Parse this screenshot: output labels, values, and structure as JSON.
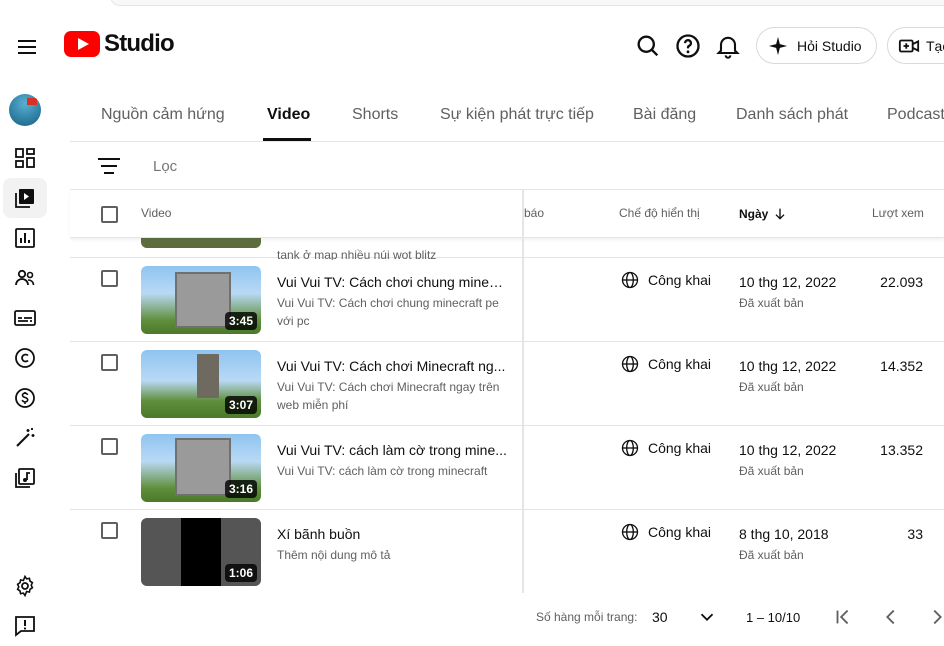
{
  "app": {
    "logo_text": "Studio"
  },
  "header": {
    "ask_label": "Hỏi Studio",
    "create_label": "Tạo",
    "icons": [
      "hamburger-icon",
      "search-icon",
      "help-icon",
      "bell-icon",
      "sparkle-icon",
      "video-add-icon"
    ]
  },
  "tabs": [
    "Nguồn cảm hứng",
    "Video",
    "Shorts",
    "Sự kiện phát trực tiếp",
    "Bài đăng",
    "Danh sách phát",
    "Podcast"
  ],
  "active_tab": "Video",
  "filter": {
    "placeholder": "Lọc"
  },
  "table": {
    "headers": {
      "video": "Video",
      "restrictions": "báo",
      "visibility": "Chế độ hiển thị",
      "date": "Ngày",
      "views": "Lượt xem"
    },
    "partial_row_desc": "tank ở map nhiều núi wot blitz",
    "rows": [
      {
        "title": "Vui Vui TV: Cách chơi chung minecr...",
        "desc": "Vui Vui TV: Cách chơi chung minecraft pe với pc",
        "duration": "3:45",
        "visibility": "Công khai",
        "date": "10 thg 12, 2022",
        "status": "Đã xuất bản",
        "views": "22.093"
      },
      {
        "title": "Vui Vui TV: Cách chơi Minecraft ng...",
        "desc": "Vui Vui TV: Cách chơi Minecraft ngay trên web miễn phí",
        "duration": "3:07",
        "visibility": "Công khai",
        "date": "10 thg 12, 2022",
        "status": "Đã xuất bản",
        "views": "14.352"
      },
      {
        "title": "Vui Vui TV: cách làm cờ trong mine...",
        "desc": "Vui Vui TV: cách làm cờ trong minecraft",
        "duration": "3:16",
        "visibility": "Công khai",
        "date": "10 thg 12, 2022",
        "status": "Đã xuất bản",
        "views": "13.352"
      },
      {
        "title": "Xí bãnh buồn",
        "desc": "Thêm nội dung mô tả",
        "duration": "1:06",
        "visibility": "Công khai",
        "date": "8 thg 10, 2018",
        "status": "Đã xuất bản",
        "views": "33"
      }
    ]
  },
  "footer": {
    "rows_per_page_label": "Số hàng mỗi trang:",
    "rows_per_page": "30",
    "range": "1 – 10/10"
  },
  "colors": {
    "brand_red": "#ff0000",
    "text": "#0f0f0f",
    "muted": "#606060"
  }
}
